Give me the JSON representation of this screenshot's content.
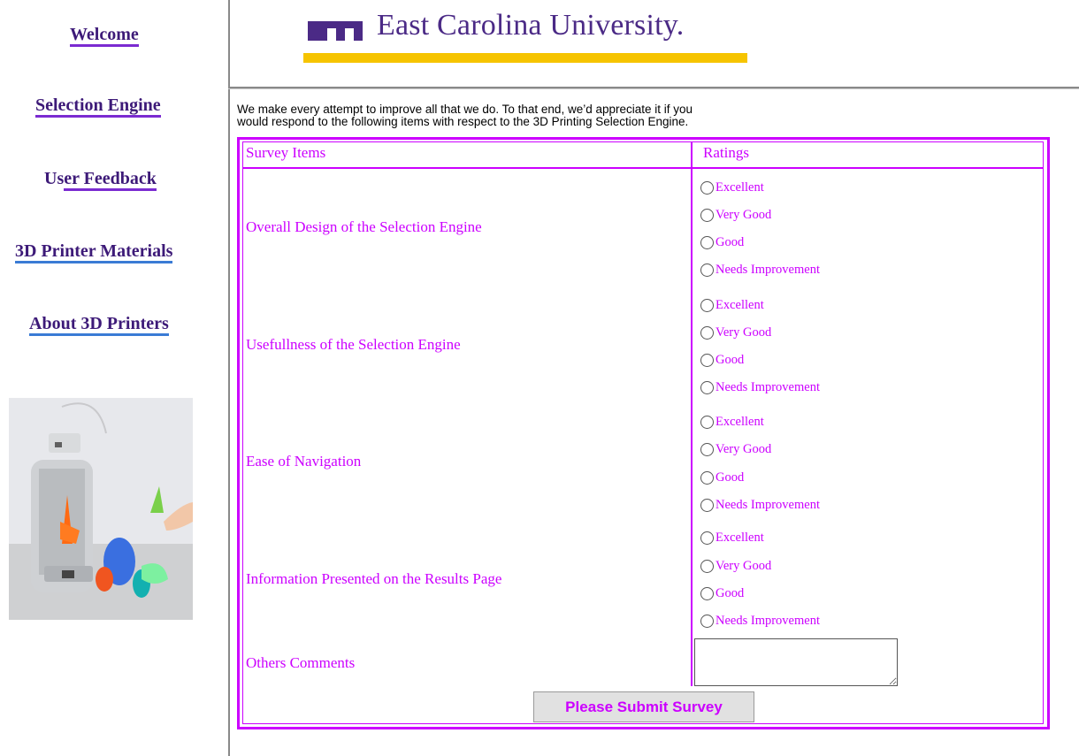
{
  "nav": {
    "welcome": "Welcome",
    "selection_engine": "Selection Engine",
    "user_feedback_prefix": "Us",
    "user_feedback_rest": "er Feedback",
    "materials": "3D Printer Materials",
    "about": "About 3D Printers"
  },
  "header": {
    "university": "East Carolina University."
  },
  "intro": {
    "line1": "We make every attempt to improve all that we do. To that end, we’d appreciate it if you",
    "line2": "would respond to the following items with respect to the 3D Printing Selection Engine."
  },
  "table": {
    "col_items": "Survey Items",
    "col_ratings": "Ratings",
    "items": [
      {
        "label": "Overall Design of the Selection Engine"
      },
      {
        "label": "Usefullness of the Selection Engine"
      },
      {
        "label": "Ease of Navigation"
      },
      {
        "label": "Information Presented on the Results Page"
      }
    ],
    "options": [
      "Excellent",
      "Very Good",
      "Good",
      "Needs Improvement"
    ],
    "comments_label": "Others Comments",
    "comments_value": ""
  },
  "submit_label": "Please Submit Survey",
  "colors": {
    "accent": "#cc00ff",
    "brand_purple": "#4b2a86",
    "gold": "#f6c400"
  }
}
